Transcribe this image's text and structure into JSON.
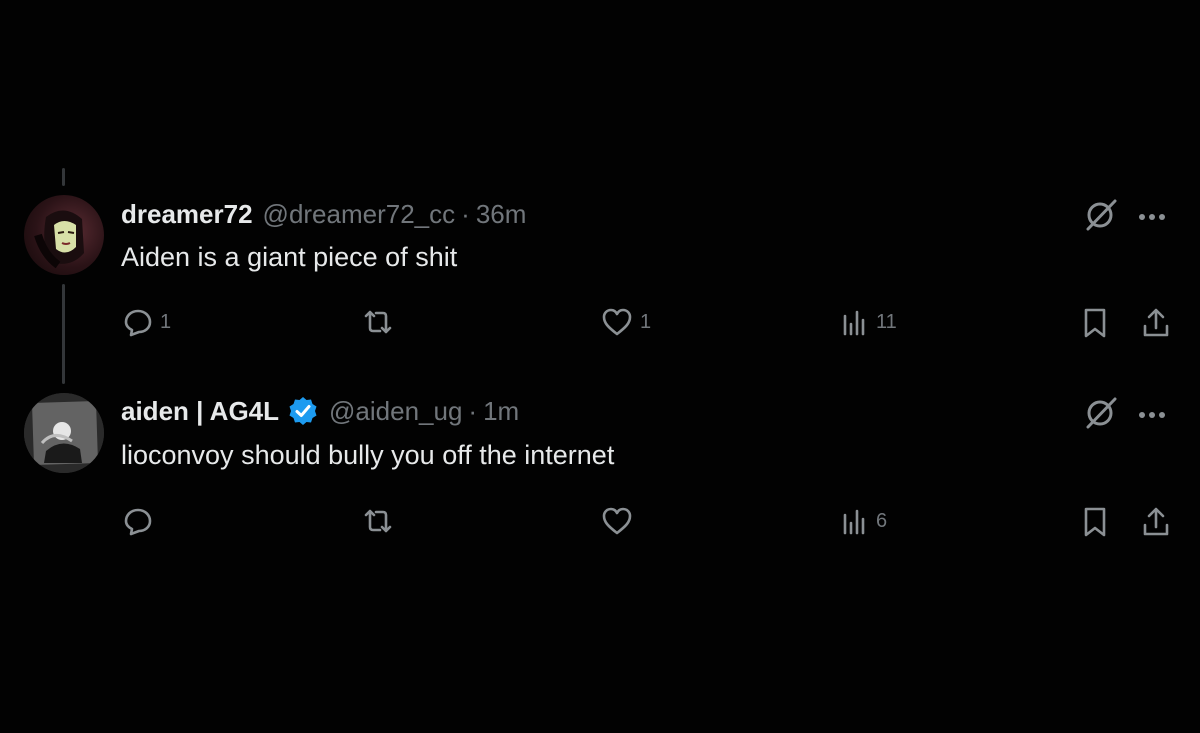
{
  "tweets": [
    {
      "name": "dreamer72",
      "handle": "@dreamer72_cc",
      "separator": "·",
      "time": "36m",
      "verified": false,
      "text": "Aiden is a giant piece of shit",
      "stats": {
        "replies": "1",
        "retweets": "",
        "likes": "1",
        "views": "11"
      }
    },
    {
      "name": "aiden | AG4L",
      "handle": "@aiden_ug",
      "separator": "·",
      "time": "1m",
      "verified": true,
      "text": "lioconvoy should bully you off the internet",
      "stats": {
        "replies": "",
        "retweets": "",
        "likes": "",
        "views": "6"
      }
    }
  ],
  "icons": {
    "grok": "grok-icon",
    "more": "more-icon",
    "reply": "reply-icon",
    "retweet": "retweet-icon",
    "like": "like-icon",
    "views": "views-icon",
    "bookmark": "bookmark-icon",
    "share": "share-icon",
    "verified": "verified-badge-icon"
  },
  "colors": {
    "background": "#020202",
    "text": "#e7e9ea",
    "muted": "#71767b",
    "verified": "#1d9bf0"
  }
}
